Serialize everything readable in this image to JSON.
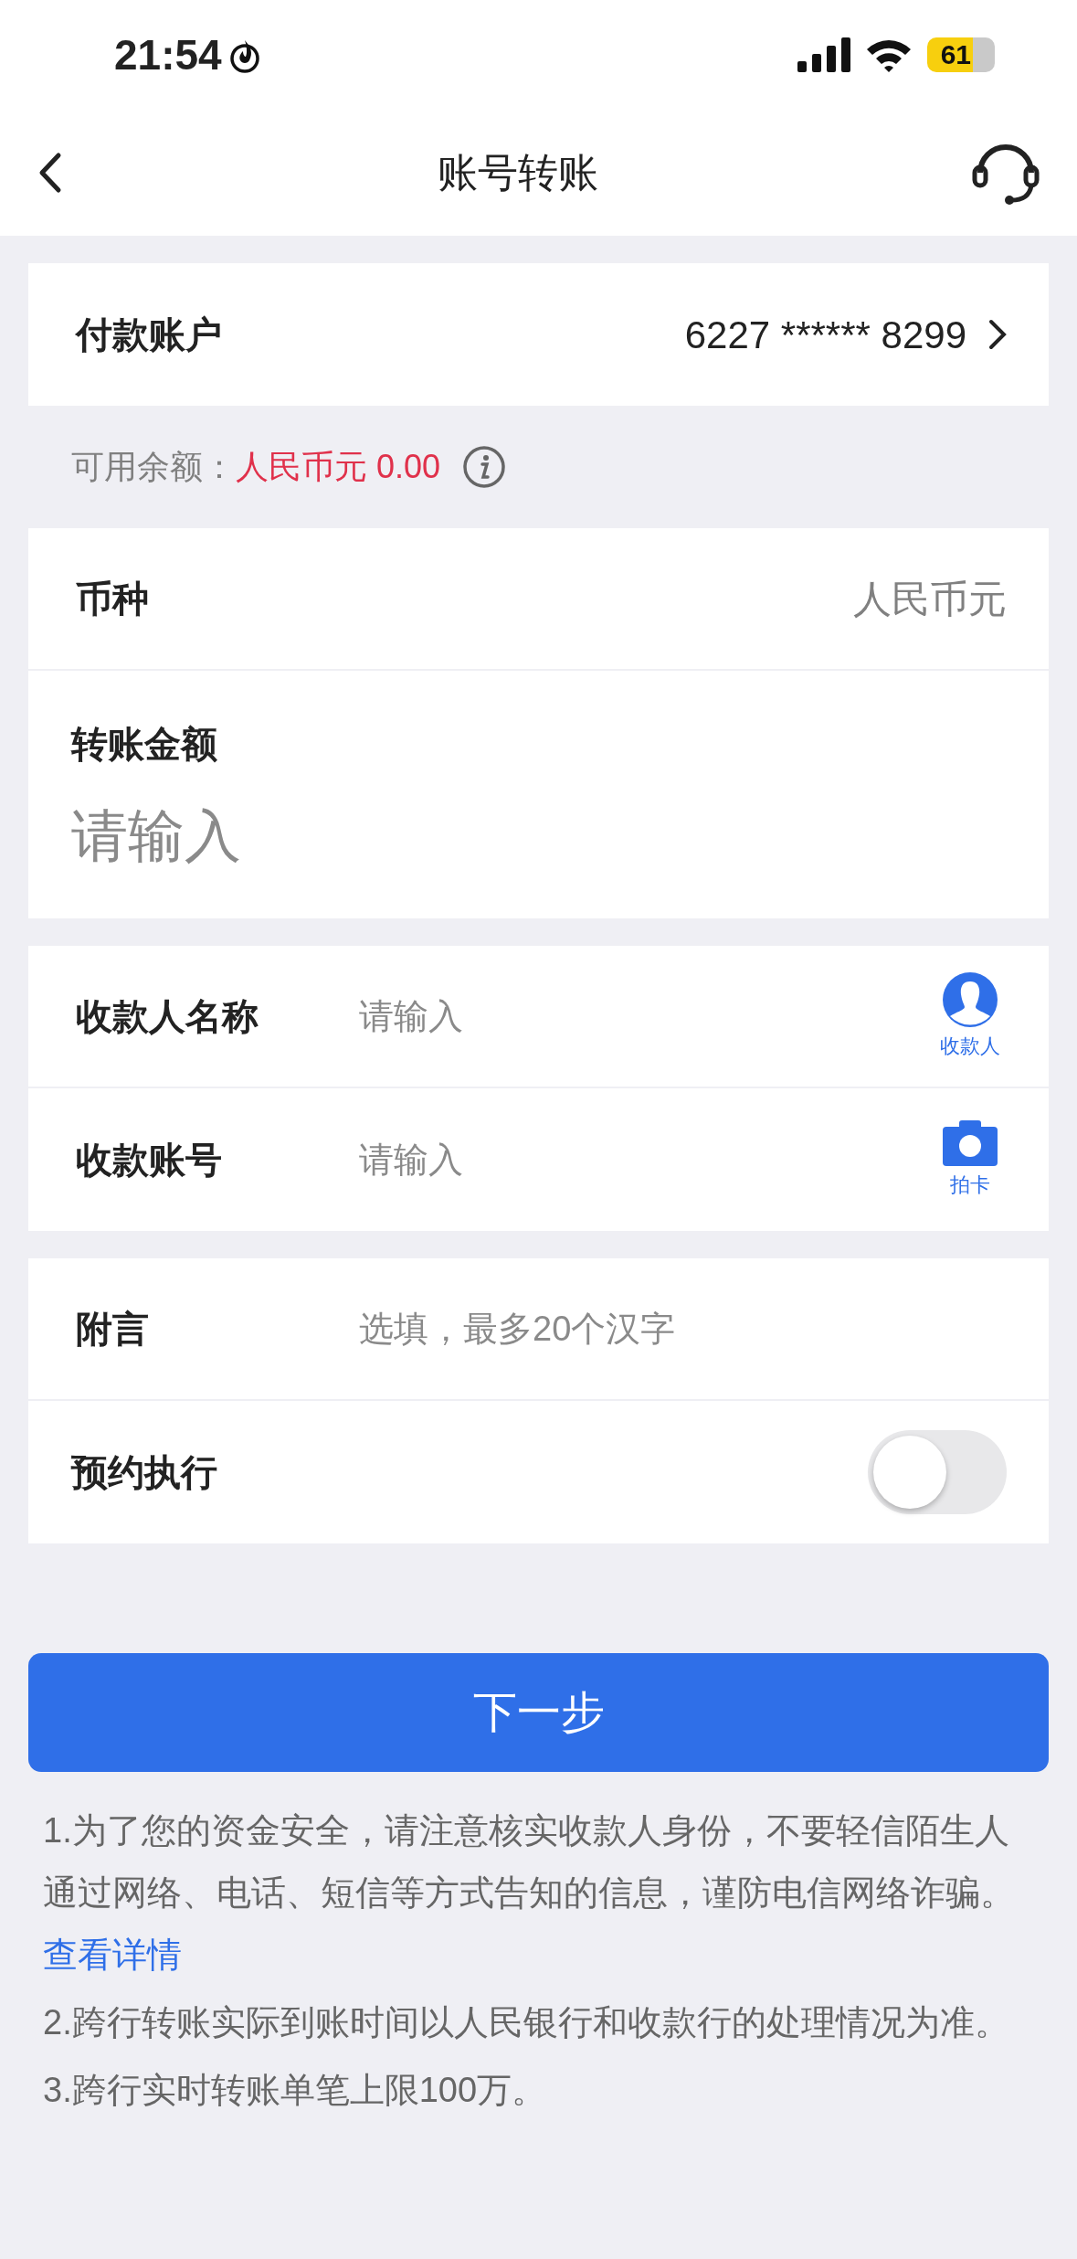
{
  "status_bar": {
    "time": "21:54",
    "battery": "61"
  },
  "header": {
    "title": "账号转账"
  },
  "payer_account": {
    "label": "付款账户",
    "value": "6227 ****** 8299"
  },
  "balance": {
    "label": "可用余额：",
    "amount": "人民币元 0.00"
  },
  "currency": {
    "label": "币种",
    "value": "人民币元"
  },
  "amount": {
    "label": "转账金额",
    "placeholder": "请输入"
  },
  "payee_fields": [
    {
      "kind": "contact",
      "label": "收款人名称",
      "placeholder": "请输入",
      "action_label": "收款人"
    },
    {
      "kind": "camera",
      "label": "收款账号",
      "placeholder": "请输入",
      "action_label": "拍卡"
    }
  ],
  "remark": {
    "label": "附言",
    "placeholder": "选填，最多20个汉字"
  },
  "schedule": {
    "label": "预约执行",
    "on": false
  },
  "next_button": "下一步",
  "notes": [
    {
      "text": "1.为了您的资金安全，请注意核实收款人身份，不要轻信陌生人通过网络、电话、短信等方式告知的信息，谨防电信网络诈骗。",
      "link": "查看详情"
    },
    {
      "text": "2.跨行转账实际到账时间以人民银行和收款行的处理情况为准。"
    },
    {
      "text": "3.跨行实时转账单笔上限100万。"
    }
  ]
}
